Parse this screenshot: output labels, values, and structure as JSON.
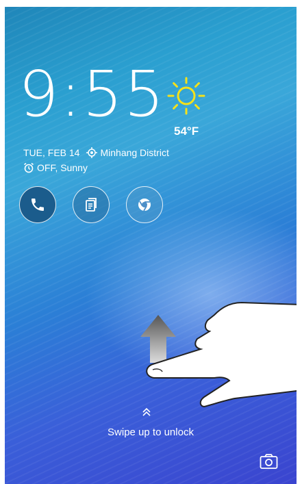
{
  "lockscreen": {
    "time": "9:55",
    "temperature": "54°F",
    "date": "TUE, FEB 14",
    "location": "Minhang District",
    "alarm_status": "OFF, Sunny",
    "unlock_hint": "Swipe up to unlock"
  },
  "shortcuts": [
    {
      "name": "phone",
      "icon": "phone-icon"
    },
    {
      "name": "notes",
      "icon": "notes-icon"
    },
    {
      "name": "browser",
      "icon": "chrome-icon"
    }
  ],
  "colors": {
    "sun": "#f5e11a",
    "text": "#ffffff",
    "phone_button": "#1b5c8c"
  }
}
